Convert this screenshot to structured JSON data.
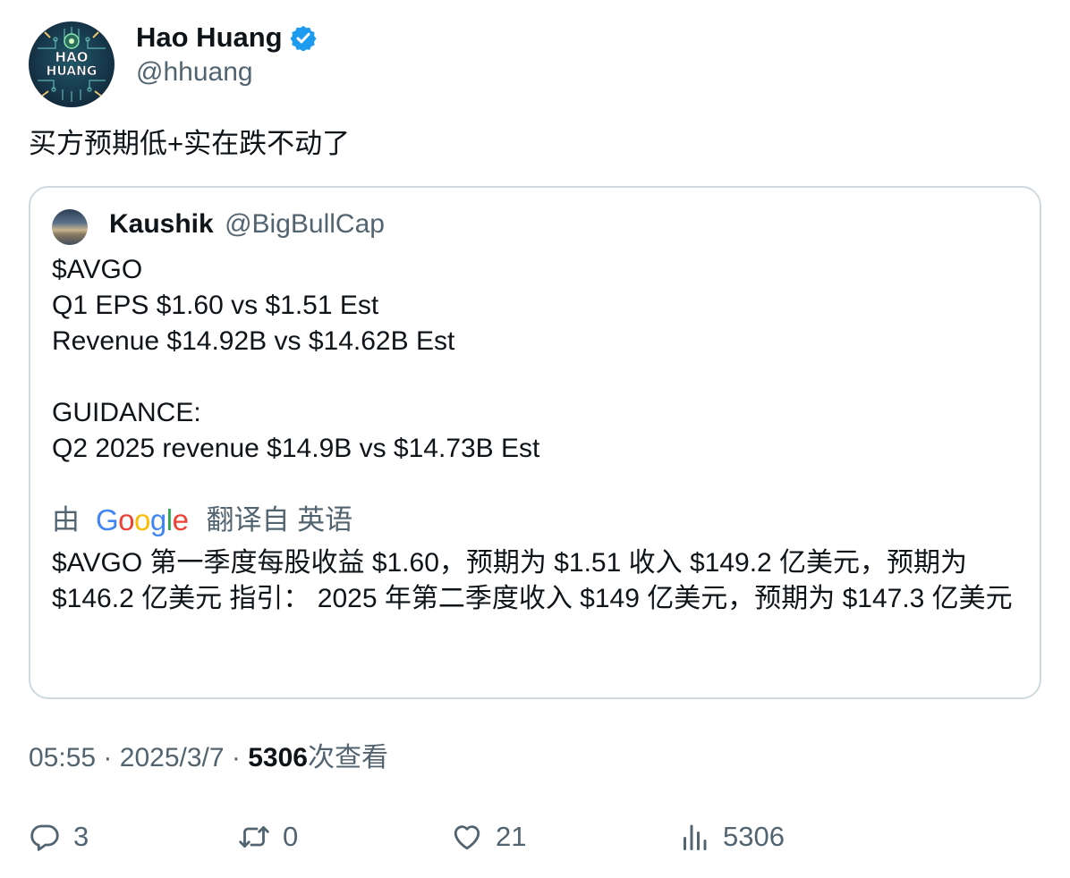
{
  "author": {
    "name": "Hao Huang",
    "handle": "@hhuang",
    "avatar_text": "HAO HUANG"
  },
  "tweet_text": "买方预期低+实在跌不动了",
  "quoted": {
    "name": "Kaushik",
    "handle": "@BigBullCap",
    "body": "$AVGO\nQ1 EPS $1.60 vs $1.51 Est\nRevenue $14.92B vs $14.62B Est\n\nGUIDANCE:\nQ2 2025 revenue $14.9B vs $14.73B Est",
    "translate_prefix": "由",
    "translate_brand": "Google",
    "translate_suffix": "翻译自 英语",
    "translation": "$AVGO 第一季度每股收益 $1.60，预期为 $1.51 收入 $149.2 亿美元，预期为 $146.2 亿美元 指引： 2025 年第二季度收入 $149 亿美元，预期为 $147.3 亿美元"
  },
  "meta": {
    "time": "05:55",
    "date": "2025/3/7",
    "separator": "·",
    "views_count": "5306",
    "views_label": "次查看"
  },
  "actions": {
    "replies": "3",
    "retweets": "0",
    "likes": "21",
    "views": "5306"
  },
  "colors": {
    "text_primary": "#0f1419",
    "text_secondary": "#536471",
    "border": "#cfd9de",
    "verified": "#1d9bf0"
  }
}
